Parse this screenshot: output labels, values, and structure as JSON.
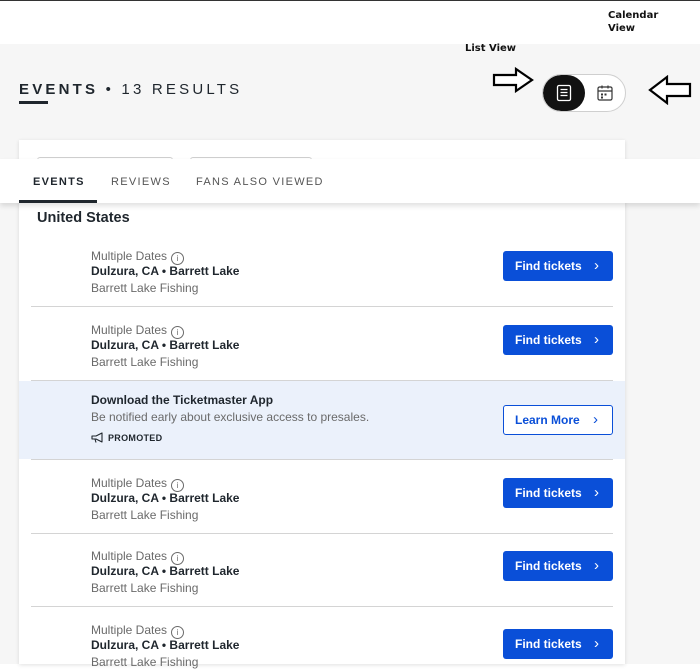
{
  "annotations": {
    "calendar_view": "Calendar View",
    "list_view": "List View"
  },
  "header": {
    "title": "EVENTS",
    "separator": "•",
    "results": "13 RESULTS"
  },
  "view_toggle": {
    "list_icon": "list-icon",
    "calendar_icon": "calendar-icon",
    "selected": "list"
  },
  "tabs": [
    {
      "label": "EVENTS",
      "active": true
    },
    {
      "label": "REVIEWS",
      "active": false
    },
    {
      "label": "FANS ALSO VIEWED",
      "active": false
    }
  ],
  "country": "United States",
  "events": [
    {
      "dates": "Multiple Dates",
      "venue": "Dulzura, CA • Barrett Lake",
      "name": "Barrett Lake Fishing",
      "button": "Find tickets"
    },
    {
      "dates": "Multiple Dates",
      "venue": "Dulzura, CA • Barrett Lake",
      "name": "Barrett Lake Fishing",
      "button": "Find tickets"
    },
    {
      "dates": "Multiple Dates",
      "venue": "Dulzura, CA • Barrett Lake",
      "name": "Barrett Lake Fishing",
      "button": "Find tickets"
    },
    {
      "dates": "Multiple Dates",
      "venue": "Dulzura, CA • Barrett Lake",
      "name": "Barrett Lake Fishing",
      "button": "Find tickets"
    },
    {
      "dates": "Multiple Dates",
      "venue": "Dulzura, CA • Barrett Lake",
      "name": "Barrett Lake Fishing",
      "button": "Find tickets"
    }
  ],
  "promo": {
    "title": "Download the Ticketmaster App",
    "subtitle": "Be notified early about exclusive access to presales.",
    "badge": "PROMOTED",
    "button": "Learn More"
  },
  "colors": {
    "primary": "#0a4fd8",
    "promo_bg": "#ebf1fb",
    "text": "#1f262d"
  }
}
